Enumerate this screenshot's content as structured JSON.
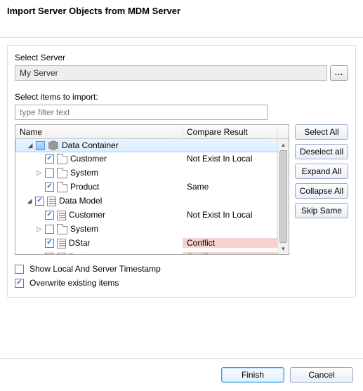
{
  "dialog": {
    "title": "Import Server Objects from MDM Server"
  },
  "server": {
    "label": "Select Server",
    "value": "My Server",
    "browse": "..."
  },
  "importSection": {
    "label": "Select items to import:",
    "filter_value": "",
    "filter_placeholder": "type filter text"
  },
  "columns": {
    "name": "Name",
    "compare": "Compare Result"
  },
  "tree": [
    {
      "level": 0,
      "expander": "open",
      "checked": "blue",
      "icon": "db",
      "label": "Data Container",
      "compare": "",
      "selected": true
    },
    {
      "level": 1,
      "expander": "none",
      "checked": "checked",
      "icon": "folder",
      "label": "Customer",
      "compare": "Not Exist In Local"
    },
    {
      "level": 1,
      "expander": "closed",
      "checked": "none",
      "icon": "folder",
      "label": "System",
      "compare": ""
    },
    {
      "level": 1,
      "expander": "none",
      "checked": "checked",
      "icon": "folder",
      "label": "Product",
      "compare": "Same"
    },
    {
      "level": 0,
      "expander": "open",
      "checked": "checked",
      "icon": "model",
      "label": "Data Model",
      "compare": ""
    },
    {
      "level": 1,
      "expander": "none",
      "checked": "checked",
      "icon": "model",
      "label": "Customer",
      "compare": "Not Exist In Local"
    },
    {
      "level": 1,
      "expander": "closed",
      "checked": "none",
      "icon": "folder",
      "label": "System",
      "compare": ""
    },
    {
      "level": 1,
      "expander": "none",
      "checked": "checked",
      "icon": "model",
      "label": "DStar",
      "compare": "Conflict",
      "conflict": true
    },
    {
      "level": 1,
      "expander": "none",
      "checked": "checked",
      "icon": "model",
      "label": "Product",
      "compare": "Conflict",
      "conflict": true
    }
  ],
  "sideButtons": {
    "select_all": "Select All",
    "deselect_all": "Deselect all",
    "expand_all": "Expand All",
    "collapse_all": "Collapse All",
    "skip_same": "Skip Same"
  },
  "options": {
    "show_timestamp": {
      "label": "Show Local And Server Timestamp",
      "checked": false
    },
    "overwrite": {
      "label": "Overwrite existing items",
      "checked": true
    }
  },
  "footer": {
    "finish": "Finish",
    "cancel": "Cancel"
  }
}
